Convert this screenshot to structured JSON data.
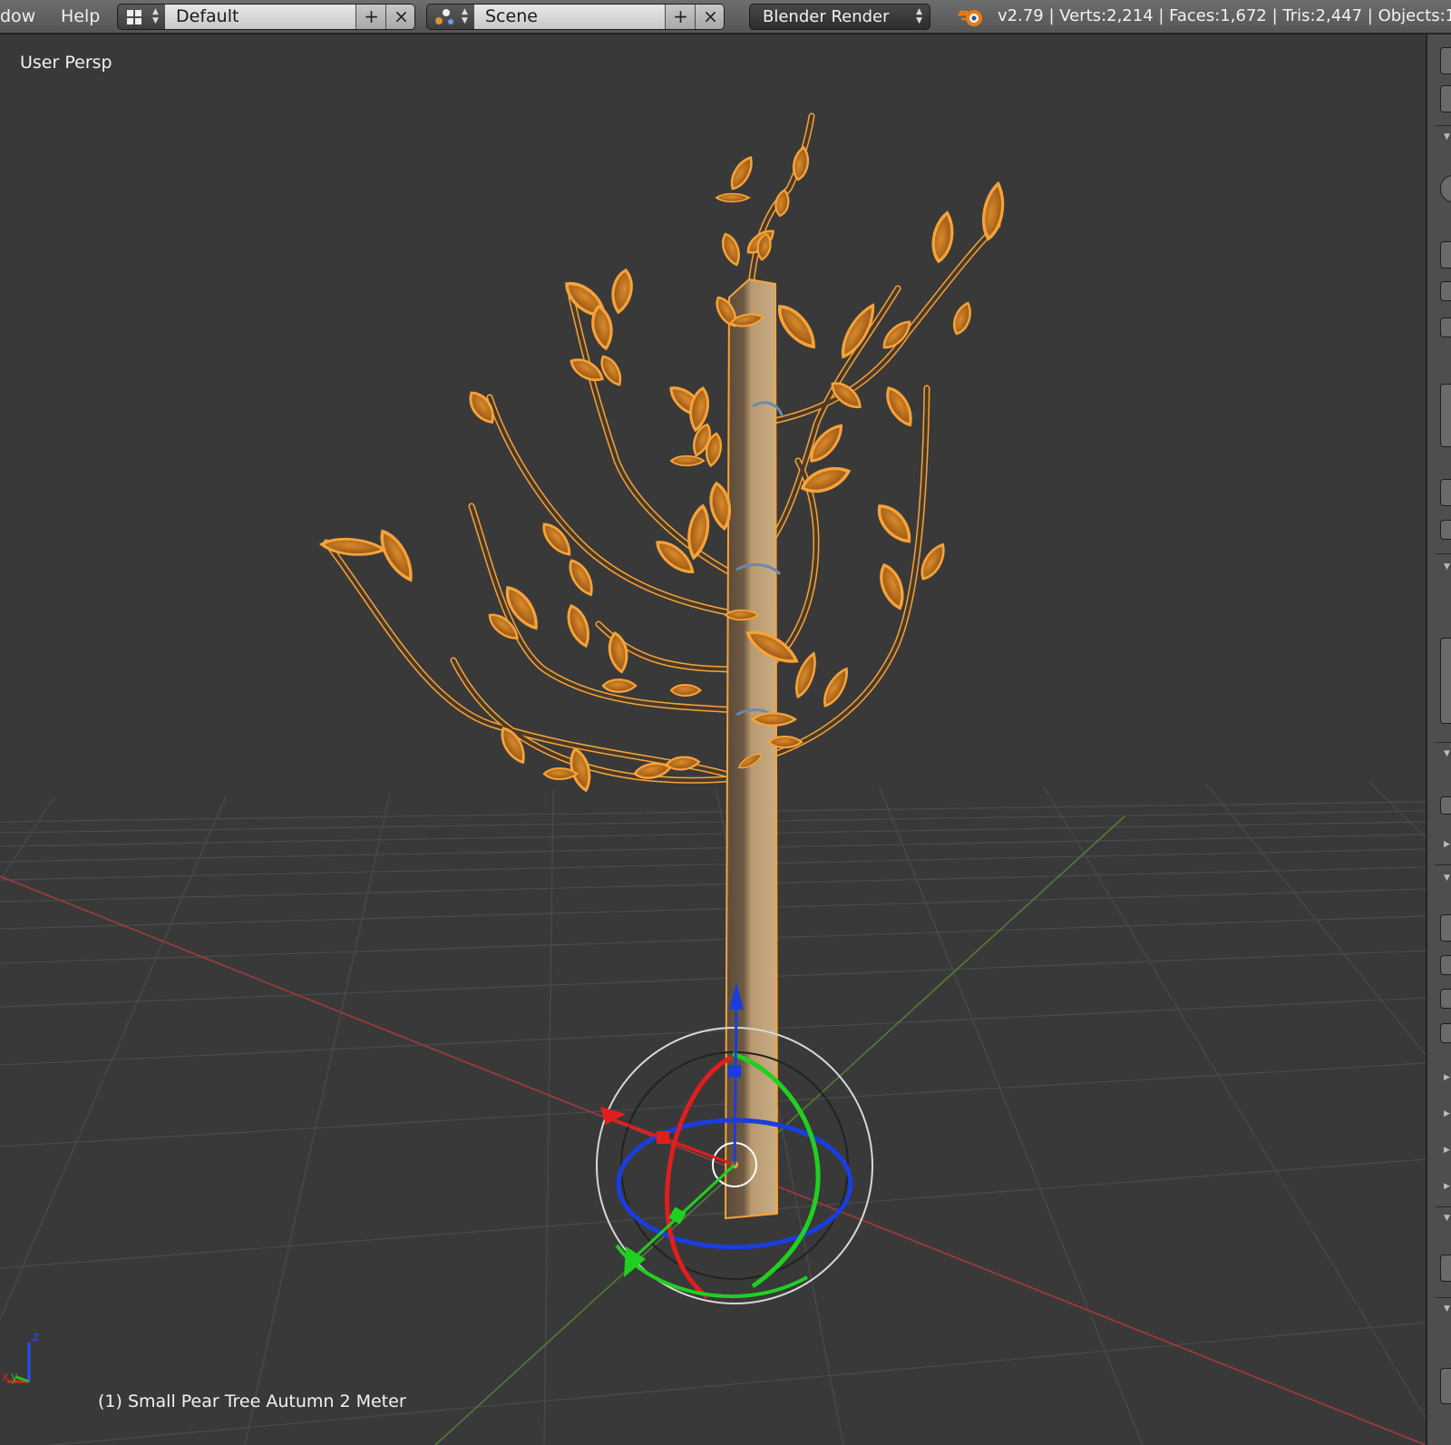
{
  "menu": {
    "window": "dow",
    "help": "Help"
  },
  "screen_layout": {
    "value": "Default",
    "add": "+",
    "close": "×"
  },
  "scene_select": {
    "value": "Scene",
    "add": "+",
    "close": "×"
  },
  "render_engine": {
    "value": "Blender Render"
  },
  "stats": {
    "text": "v2.79 | Verts:2,214 | Faces:1,672 | Tris:2,447 | Objects:1"
  },
  "viewport": {
    "view_label": "User Persp",
    "object_label": "(1) Small Pear Tree Autumn 2 Meter",
    "axis_x": "x",
    "axis_y": "y",
    "axis_z": "z"
  },
  "colors": {
    "background": "#393939",
    "grid": "#4a4a4a",
    "x_axis": "#a63a3a",
    "y_axis": "#4f7d3a",
    "selection_outline": "#f5a33a",
    "leaf": "#b5651d",
    "trunk": "#b49468",
    "gizmo_x": "#e11e1e",
    "gizmo_y": "#20d020",
    "gizmo_z": "#1a3dde"
  },
  "icons": [
    "screen-layout-icon",
    "scene-icon",
    "blender-logo-icon",
    "axis-orientation-icon",
    "move-manipulator-icon",
    "rotate-manipulator-icon"
  ]
}
